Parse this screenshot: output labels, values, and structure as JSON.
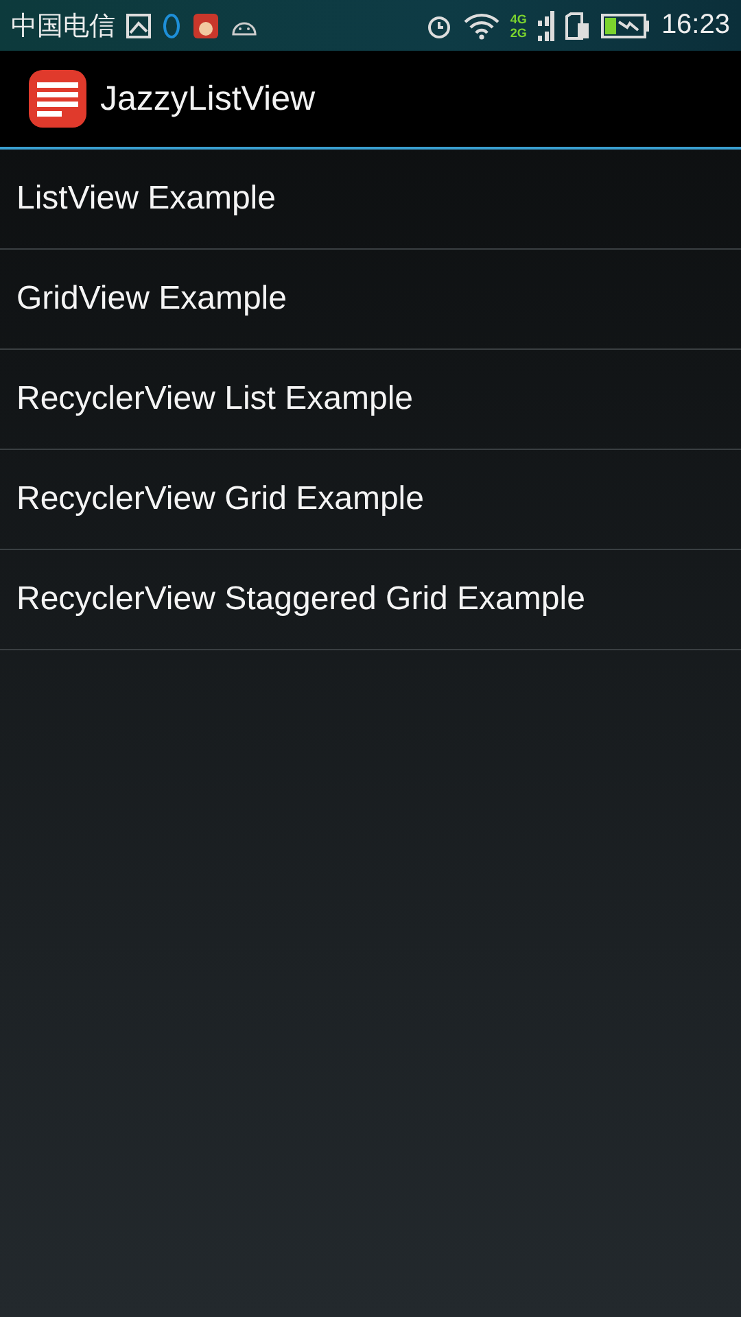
{
  "status_bar": {
    "carrier": "中国电信",
    "network_top": "4G",
    "network_bottom": "2G",
    "time": "16:23"
  },
  "action_bar": {
    "title": "JazzyListView"
  },
  "items": [
    {
      "label": "ListView Example"
    },
    {
      "label": "GridView Example"
    },
    {
      "label": "RecyclerView List Example"
    },
    {
      "label": "RecyclerView Grid Example"
    },
    {
      "label": "RecyclerView Staggered Grid Example"
    }
  ]
}
